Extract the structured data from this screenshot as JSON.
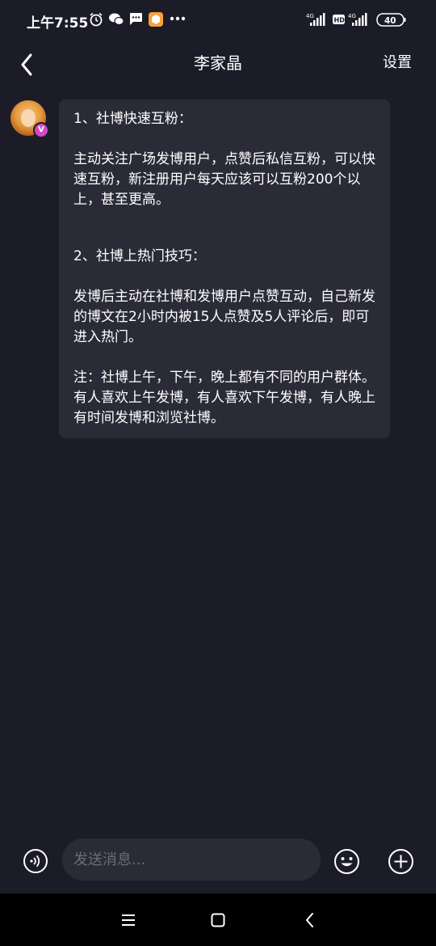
{
  "status_bar": {
    "time": "上午7:55",
    "battery": "40",
    "network": "4G",
    "network2": "4G",
    "hd": "HD"
  },
  "header": {
    "title": "李家晶",
    "settings_label": "设置"
  },
  "message": {
    "badge": "V",
    "section1_title": "1、社博快速互粉：",
    "section1_body": "主动关注广场发博用户，点赞后私信互粉，可以快速互粉，新注册用户每天应该可以互粉200个以上，甚至更高。",
    "section2_title": "2、社博上热门技巧：",
    "section2_body": "发博后主动在社博和发博用户点赞互动，自己新发的博文在2小时内被15人点赞及5人评论后，即可进入热门。",
    "note": "注：社博上午，下午，晚上都有不同的用户群体。有人喜欢上午发博，有人喜欢下午发博，有人晚上有时间发博和浏览社博。"
  },
  "input_bar": {
    "placeholder": "发送消息..."
  },
  "colors": {
    "background": "#1b1c28",
    "bubble": "#2a2b37",
    "badge": "#d24ac6"
  }
}
